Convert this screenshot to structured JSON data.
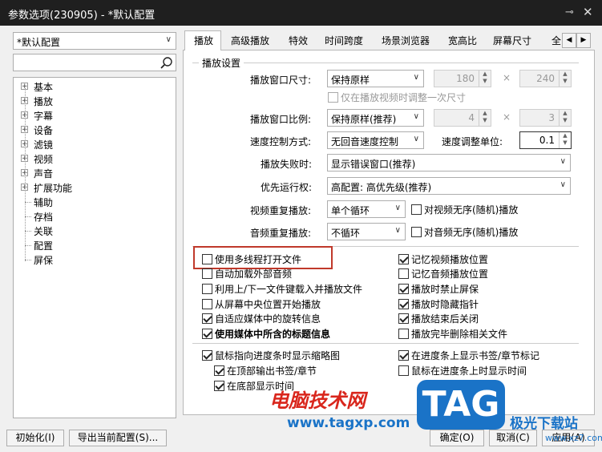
{
  "window": {
    "title": "参数选项(230905) - *默认配置",
    "pin_icon": "pin-icon",
    "close_icon": "close-icon"
  },
  "sidebar": {
    "profile": "*默认配置",
    "search_placeholder": "",
    "tree": [
      {
        "label": "基本",
        "expand": "+"
      },
      {
        "label": "播放",
        "expand": "+"
      },
      {
        "label": "字幕",
        "expand": "+"
      },
      {
        "label": "设备",
        "expand": "+"
      },
      {
        "label": "滤镜",
        "expand": "+"
      },
      {
        "label": "视频",
        "expand": "+"
      },
      {
        "label": "声音",
        "expand": "+"
      },
      {
        "label": "扩展功能",
        "expand": "+"
      },
      {
        "label": "辅助",
        "expand": ""
      },
      {
        "label": "存档",
        "expand": ""
      },
      {
        "label": "关联",
        "expand": ""
      },
      {
        "label": "配置",
        "expand": ""
      },
      {
        "label": "屏保",
        "expand": ""
      }
    ]
  },
  "tabs": [
    "播放",
    "高级播放",
    "特效",
    "时间跨度",
    "场景浏览器",
    "宽高比",
    "屏幕尺寸",
    "全"
  ],
  "group1": {
    "title": "播放设置",
    "window_size_label": "播放窗口尺寸:",
    "window_size_value": "保持原样",
    "width": "180",
    "times": "×",
    "height": "240",
    "adjust_once": "仅在播放视频时调整一次尺寸",
    "ratio_label": "播放窗口比例:",
    "ratio_value": "保持原样(推荐)",
    "ratio_w": "4",
    "ratio_h": "3",
    "speed_mode_label": "速度控制方式:",
    "speed_mode_value": "无回音速度控制",
    "speed_unit_label": "速度调整单位:",
    "speed_unit_value": "0.1",
    "fail_label": "播放失败时:",
    "fail_value": "显示错误窗口(推荐)",
    "priority_label": "优先运行权:",
    "priority_value": "高配置: 高优先级(推荐)",
    "video_repeat_label": "视频重复播放:",
    "video_repeat_value": "单个循环",
    "video_random": "对视频无序(随机)播放",
    "audio_repeat_label": "音频重复播放:",
    "audio_repeat_value": "不循环",
    "audio_random": "对音频无序(随机)播放"
  },
  "options_left": [
    {
      "label": "使用多线程打开文件",
      "checked": false,
      "bold": false
    },
    {
      "label": "自动加载外部音频",
      "checked": false,
      "bold": false
    },
    {
      "label": "利用上/下一文件键载入并播放文件",
      "checked": false,
      "bold": false
    },
    {
      "label": "从屏幕中央位置开始播放",
      "checked": false,
      "bold": false
    },
    {
      "label": "自适应媒体中的旋转信息",
      "checked": true,
      "bold": false
    },
    {
      "label": "使用媒体中所含的标题信息",
      "checked": true,
      "bold": true
    }
  ],
  "options_right": [
    {
      "label": "记忆视频播放位置",
      "checked": true
    },
    {
      "label": "记忆音频播放位置",
      "checked": false
    },
    {
      "label": "播放时禁止屏保",
      "checked": true
    },
    {
      "label": "播放时隐藏指针",
      "checked": true
    },
    {
      "label": "播放结束后关闭",
      "checked": true
    },
    {
      "label": "播放完毕删除相关文件",
      "checked": false
    }
  ],
  "group3": {
    "thumb": "鼠标指向进度条时显示缩略图",
    "bookmark_top": "在顶部输出书签/章节",
    "time_bottom": "在底部显示时间",
    "show_bookmarks": "在进度条上显示书签/章节标记",
    "show_time": "鼠标在进度条上时显示时间"
  },
  "buttons": {
    "init": "初始化(I)",
    "export": "导出当前配置(S)...",
    "ok": "确定(O)",
    "cancel": "取消(C)",
    "apply": "应用(A)"
  },
  "watermark": {
    "site_name": "电脑技术网",
    "site_url": "www.tagxp.com",
    "logo": "TAG",
    "right_text": "极光下载站",
    "right_url": "www.xz7.com"
  },
  "colors": {
    "titlebar": "#1f1f1f",
    "highlight_box": "#c0392b",
    "watermark_red": "#d9261c",
    "watermark_blue": "#1a73c7"
  }
}
